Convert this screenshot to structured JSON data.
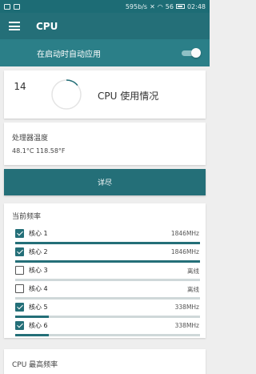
{
  "status_bar": {
    "network_speed": "595b/s",
    "signal": "56",
    "time": "02:48"
  },
  "app_bar": {
    "title": "CPU"
  },
  "auto_apply": {
    "label": "在启动时自动应用",
    "enabled": true
  },
  "usage": {
    "value": "14",
    "percent": 14,
    "title": "CPU 使用情况",
    "accent_color": "#246f78"
  },
  "temperature": {
    "title": "处理器温度",
    "value": "48.1°C 118.58°F"
  },
  "detail_button": {
    "label": "详尽"
  },
  "current_freq": {
    "title": "当前频率",
    "cores": [
      {
        "label": "核心 1",
        "freq": "1846MHz",
        "checked": true,
        "load": 1.0
      },
      {
        "label": "核心 2",
        "freq": "1846MHz",
        "checked": true,
        "load": 1.0
      },
      {
        "label": "核心 3",
        "freq": "离线",
        "checked": false,
        "load": 0
      },
      {
        "label": "核心 4",
        "freq": "离线",
        "checked": false,
        "load": 0
      },
      {
        "label": "核心 5",
        "freq": "338MHz",
        "checked": true,
        "load": 0.18
      },
      {
        "label": "核心 6",
        "freq": "338MHz",
        "checked": true,
        "load": 0.18
      }
    ]
  },
  "max_freq": {
    "title": "CPU 最高频率"
  }
}
